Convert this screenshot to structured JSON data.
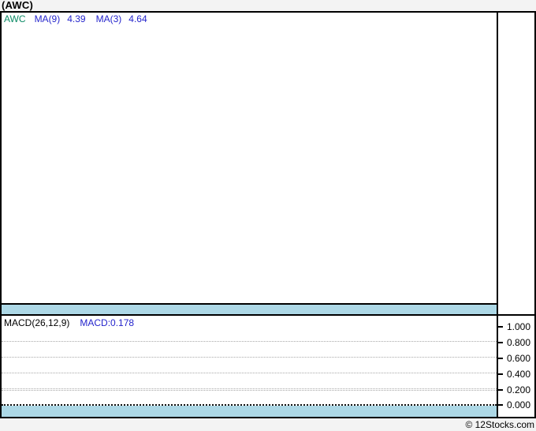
{
  "header": {
    "title": "(AWC)"
  },
  "price_panel": {
    "legend": {
      "ticker": "AWC",
      "ma9_label": "MA(9)",
      "ma9_value": "4.39",
      "ma3_label": "MA(3)",
      "ma3_value": "4.64"
    }
  },
  "macd_panel": {
    "label": "MACD(26,12,9)",
    "value_label": "MACD:0.178",
    "axis_ticks": [
      "1.000",
      "0.800",
      "0.600",
      "0.400",
      "0.200",
      "0.000"
    ]
  },
  "footer": {
    "credit": "© 12Stocks.com"
  },
  "colors": {
    "page_background": "#f3f3f3",
    "panel_background": "#ffffff",
    "border": "#000000",
    "band": "#add8e6",
    "ticker_text": "#0c8a65",
    "indicator_text": "#2424cc",
    "grid": "#a9a9a9"
  },
  "chart_data": [
    {
      "type": "line",
      "title": "AWC price panel",
      "series": [
        {
          "name": "MA(9)",
          "last_value": 4.39,
          "values": []
        },
        {
          "name": "MA(3)",
          "last_value": 4.64,
          "values": []
        }
      ],
      "legend_position": "top-left",
      "grid": false,
      "note": "panel is empty - no plotted data visible"
    },
    {
      "type": "line",
      "title": "MACD(26,12,9)",
      "series": [
        {
          "name": "MACD",
          "last_value": 0.178,
          "values": []
        }
      ],
      "ylabel": "",
      "ylim": [
        0.0,
        1.16
      ],
      "yticks": [
        1.0,
        0.8,
        0.6,
        0.4,
        0.2,
        0.0
      ],
      "legend_position": "top-left",
      "grid": true,
      "note": "panel is empty - no plotted data visible; axis on right side"
    }
  ]
}
